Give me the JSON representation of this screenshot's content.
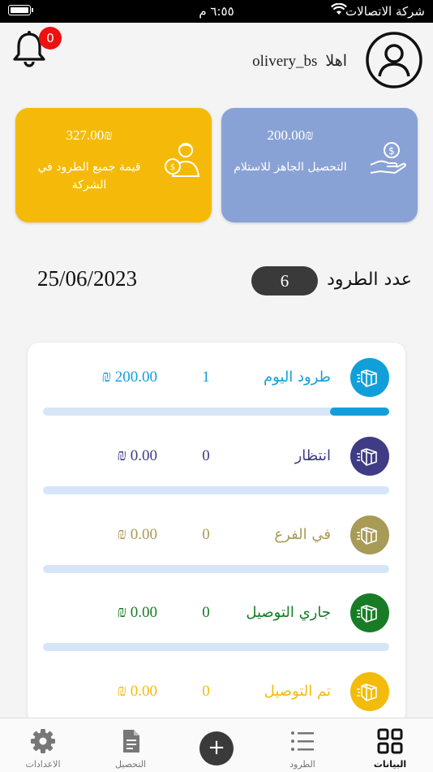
{
  "status_bar": {
    "carrier": "شركة الاتصالات",
    "time": "٦:٥٥ م"
  },
  "header": {
    "greeting": "اهلا",
    "username": "olivery_bs",
    "notifications_count": "0"
  },
  "cards": {
    "company_total": {
      "amount": "327.00₪",
      "label": "قيمة جميع الطرود في الشركة",
      "color": "#f5ba09"
    },
    "ready_collection": {
      "amount": "200.00₪",
      "label": "التحصيل الجاهز للاستلام",
      "color": "#89a2d5"
    }
  },
  "summary": {
    "date": "25/06/2023",
    "parcels_label": "عدد الطرود",
    "parcels_count": "6"
  },
  "rows": [
    {
      "label": "طرود اليوم",
      "count": "1",
      "amount": "₪ 200.00",
      "color": "#119fda",
      "progress": 0.17
    },
    {
      "label": "انتظار",
      "count": "0",
      "amount": "₪ 0.00",
      "color": "#3f3c85",
      "progress": 0
    },
    {
      "label": "في الفرع",
      "count": "0",
      "amount": "₪ 0.00",
      "color": "#a89a57",
      "progress": 0
    },
    {
      "label": "جاري التوصيل",
      "count": "0",
      "amount": "₪ 0.00",
      "color": "#177c25",
      "progress": 0
    },
    {
      "label": "تم التوصيل",
      "count": "0",
      "amount": "₪ 0.00",
      "color": "#f3bb0c",
      "progress": 0
    }
  ],
  "tabbar": {
    "data": "البيانات",
    "parcels": "الطرود",
    "add": "+",
    "collection": "التحصيل",
    "settings": "الاعدادات"
  },
  "icons": {
    "bell": "bell-icon",
    "avatar": "user-circle-icon",
    "box": "package-icon",
    "grid": "grid-icon",
    "list": "list-icon",
    "document": "document-icon",
    "gear": "gear-icon"
  }
}
